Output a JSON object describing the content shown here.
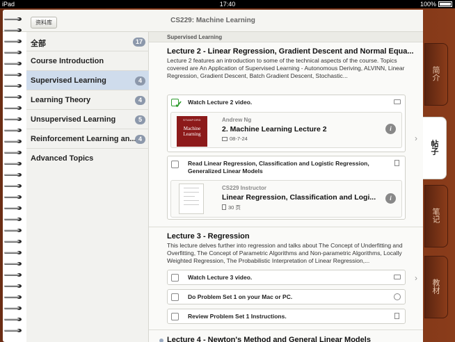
{
  "status_bar": {
    "carrier": "iPad",
    "time": "17:40",
    "battery": "100%"
  },
  "header": {
    "library_button": "资料库",
    "title": "CS229: Machine Learning"
  },
  "sidebar": {
    "items": [
      {
        "label": "全部",
        "badge": "17"
      },
      {
        "label": "Course Introduction",
        "badge": ""
      },
      {
        "label": "Supervised Learning",
        "badge": "4"
      },
      {
        "label": "Learning Theory",
        "badge": "4"
      },
      {
        "label": "Unsupervised Learning",
        "badge": "5"
      },
      {
        "label": "Reinforcement Learning an...",
        "badge": "4"
      },
      {
        "label": "Advanced Topics",
        "badge": ""
      }
    ],
    "selected_index": 2
  },
  "main": {
    "section_header": "Supervised Learning",
    "lectures": [
      {
        "title": "Lecture 2 - Linear Regression, Gradient Descent and Normal Equa...",
        "description": "Lecture 2 features an introduction to some of the technical aspects of the course. Topics covered are An Application of Supervised Learning - Autonomous Deriving, ALVINN, Linear Regression, Gradient Descent, Batch Gradient Descent, Stochastic...",
        "tasks": [
          {
            "label": "Watch Lecture 2 video.",
            "checked": true,
            "icon": "video-icon",
            "resource": {
              "cover_top": "STANFORD",
              "cover_title": "Machine Learning",
              "author": "Andrew Ng",
              "title": "2. Machine Learning Lecture 2",
              "meta": "08-7-24",
              "meta_icon": "video-icon"
            }
          },
          {
            "label": "Read Linear Regression, Classification and Logistic Regression, Generalized Linear Models",
            "checked": false,
            "icon": "document-icon",
            "resource": {
              "author": "CS229 Instructor",
              "title": "Linear Regression, Classification and Logi...",
              "meta": "30 页",
              "meta_icon": "document-icon"
            }
          }
        ]
      },
      {
        "title": "Lecture 3 - Regression",
        "description": "This lecture delves further into regression and talks about The Concept of Underfitting and Overfitting, The Concept of Parametric Algorithms and Non-parametric Algorithms, Locally Weighted Regression, The Probabilistic Interpretation of Linear Regression,...",
        "tasks": [
          {
            "label": "Watch Lecture 3 video.",
            "checked": false,
            "icon": "video-icon"
          },
          {
            "label": "Do Problem Set 1 on your Mac or PC.",
            "checked": false,
            "icon": "clock-icon"
          },
          {
            "label": "Review Problem Set 1 Instructions.",
            "checked": false,
            "icon": "document-icon"
          }
        ]
      },
      {
        "title": "Lecture 4 - Newton's Method and General Linear Models"
      }
    ]
  },
  "tabs": [
    {
      "label": "简介",
      "active": false
    },
    {
      "label": "帖子",
      "active": true
    },
    {
      "label": "笔记",
      "active": false
    },
    {
      "label": "教材",
      "active": false
    }
  ],
  "colors": {
    "selected_row": "#cfdcec",
    "badge": "#8c98ab",
    "wood": "#8c3d1b",
    "cover": "#8c1a1a",
    "check": "#2d9b2d"
  }
}
